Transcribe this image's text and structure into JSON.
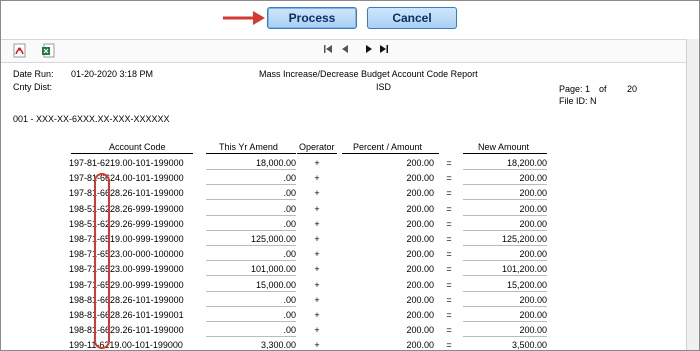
{
  "actions": {
    "process_label": "Process",
    "cancel_label": "Cancel"
  },
  "toolbar": {
    "icons": [
      "pdf-export-icon",
      "excel-export-icon"
    ],
    "nav": {
      "first": "|◀",
      "prev": "◀",
      "next": "▶",
      "last": "▶|"
    }
  },
  "report": {
    "date_run_label": "Date Run:",
    "date_run_value": "01-20-2020 3:18 PM",
    "title": "Mass Increase/Decrease Budget Account Code Report",
    "cnty_dist_label": "Cnty Dist:",
    "district": "ISD",
    "page_label": "Page:",
    "page_num": "1",
    "of_label": "of",
    "page_total": "20",
    "file_id_label": "File ID:",
    "file_id_value": "N",
    "account_mask": "001 - XXX-XX-6XXX.XX-XXX-XXXXXX",
    "columns": {
      "account_code": "Account Code",
      "this_yr_amend": "This Yr Amend",
      "operator": "Operator",
      "percent_amount": "Percent / Amount",
      "new_amount": "New Amount"
    },
    "rows": [
      {
        "account": "197-81-6219.00-101-199000",
        "amend": "18,000.00",
        "op": "+",
        "pct": "200.00",
        "eq": "=",
        "new": "18,200.00"
      },
      {
        "account": "197-81-6624.00-101-199000",
        "amend": ".00",
        "op": "+",
        "pct": "200.00",
        "eq": "=",
        "new": "200.00"
      },
      {
        "account": "197-81-6628.26-101-199000",
        "amend": ".00",
        "op": "+",
        "pct": "200.00",
        "eq": "=",
        "new": "200.00"
      },
      {
        "account": "198-51-6228.26-999-199000",
        "amend": ".00",
        "op": "+",
        "pct": "200.00",
        "eq": "=",
        "new": "200.00"
      },
      {
        "account": "198-51-6229.26-999-199000",
        "amend": ".00",
        "op": "+",
        "pct": "200.00",
        "eq": "=",
        "new": "200.00"
      },
      {
        "account": "198-71-6519.00-999-199000",
        "amend": "125,000.00",
        "op": "+",
        "pct": "200.00",
        "eq": "=",
        "new": "125,200.00"
      },
      {
        "account": "198-71-6523.00-000-100000",
        "amend": ".00",
        "op": "+",
        "pct": "200.00",
        "eq": "=",
        "new": "200.00"
      },
      {
        "account": "198-71-6523.00-999-199000",
        "amend": "101,000.00",
        "op": "+",
        "pct": "200.00",
        "eq": "=",
        "new": "101,200.00"
      },
      {
        "account": "198-71-6529.00-999-199000",
        "amend": "15,000.00",
        "op": "+",
        "pct": "200.00",
        "eq": "=",
        "new": "15,200.00"
      },
      {
        "account": "198-81-6628.26-101-199000",
        "amend": ".00",
        "op": "+",
        "pct": "200.00",
        "eq": "=",
        "new": "200.00"
      },
      {
        "account": "198-81-6628.26-101-199001",
        "amend": ".00",
        "op": "+",
        "pct": "200.00",
        "eq": "=",
        "new": "200.00"
      },
      {
        "account": "198-81-6629.26-101-199000",
        "amend": ".00",
        "op": "+",
        "pct": "200.00",
        "eq": "=",
        "new": "200.00"
      },
      {
        "account": "199-11-6219.00-101-199000",
        "amend": "3,300.00",
        "op": "+",
        "pct": "200.00",
        "eq": "=",
        "new": "3,500.00"
      }
    ]
  },
  "colors": {
    "annotation_red": "#d23a32",
    "button_border": "#3a7bc8",
    "button_text": "#0b2f63"
  }
}
